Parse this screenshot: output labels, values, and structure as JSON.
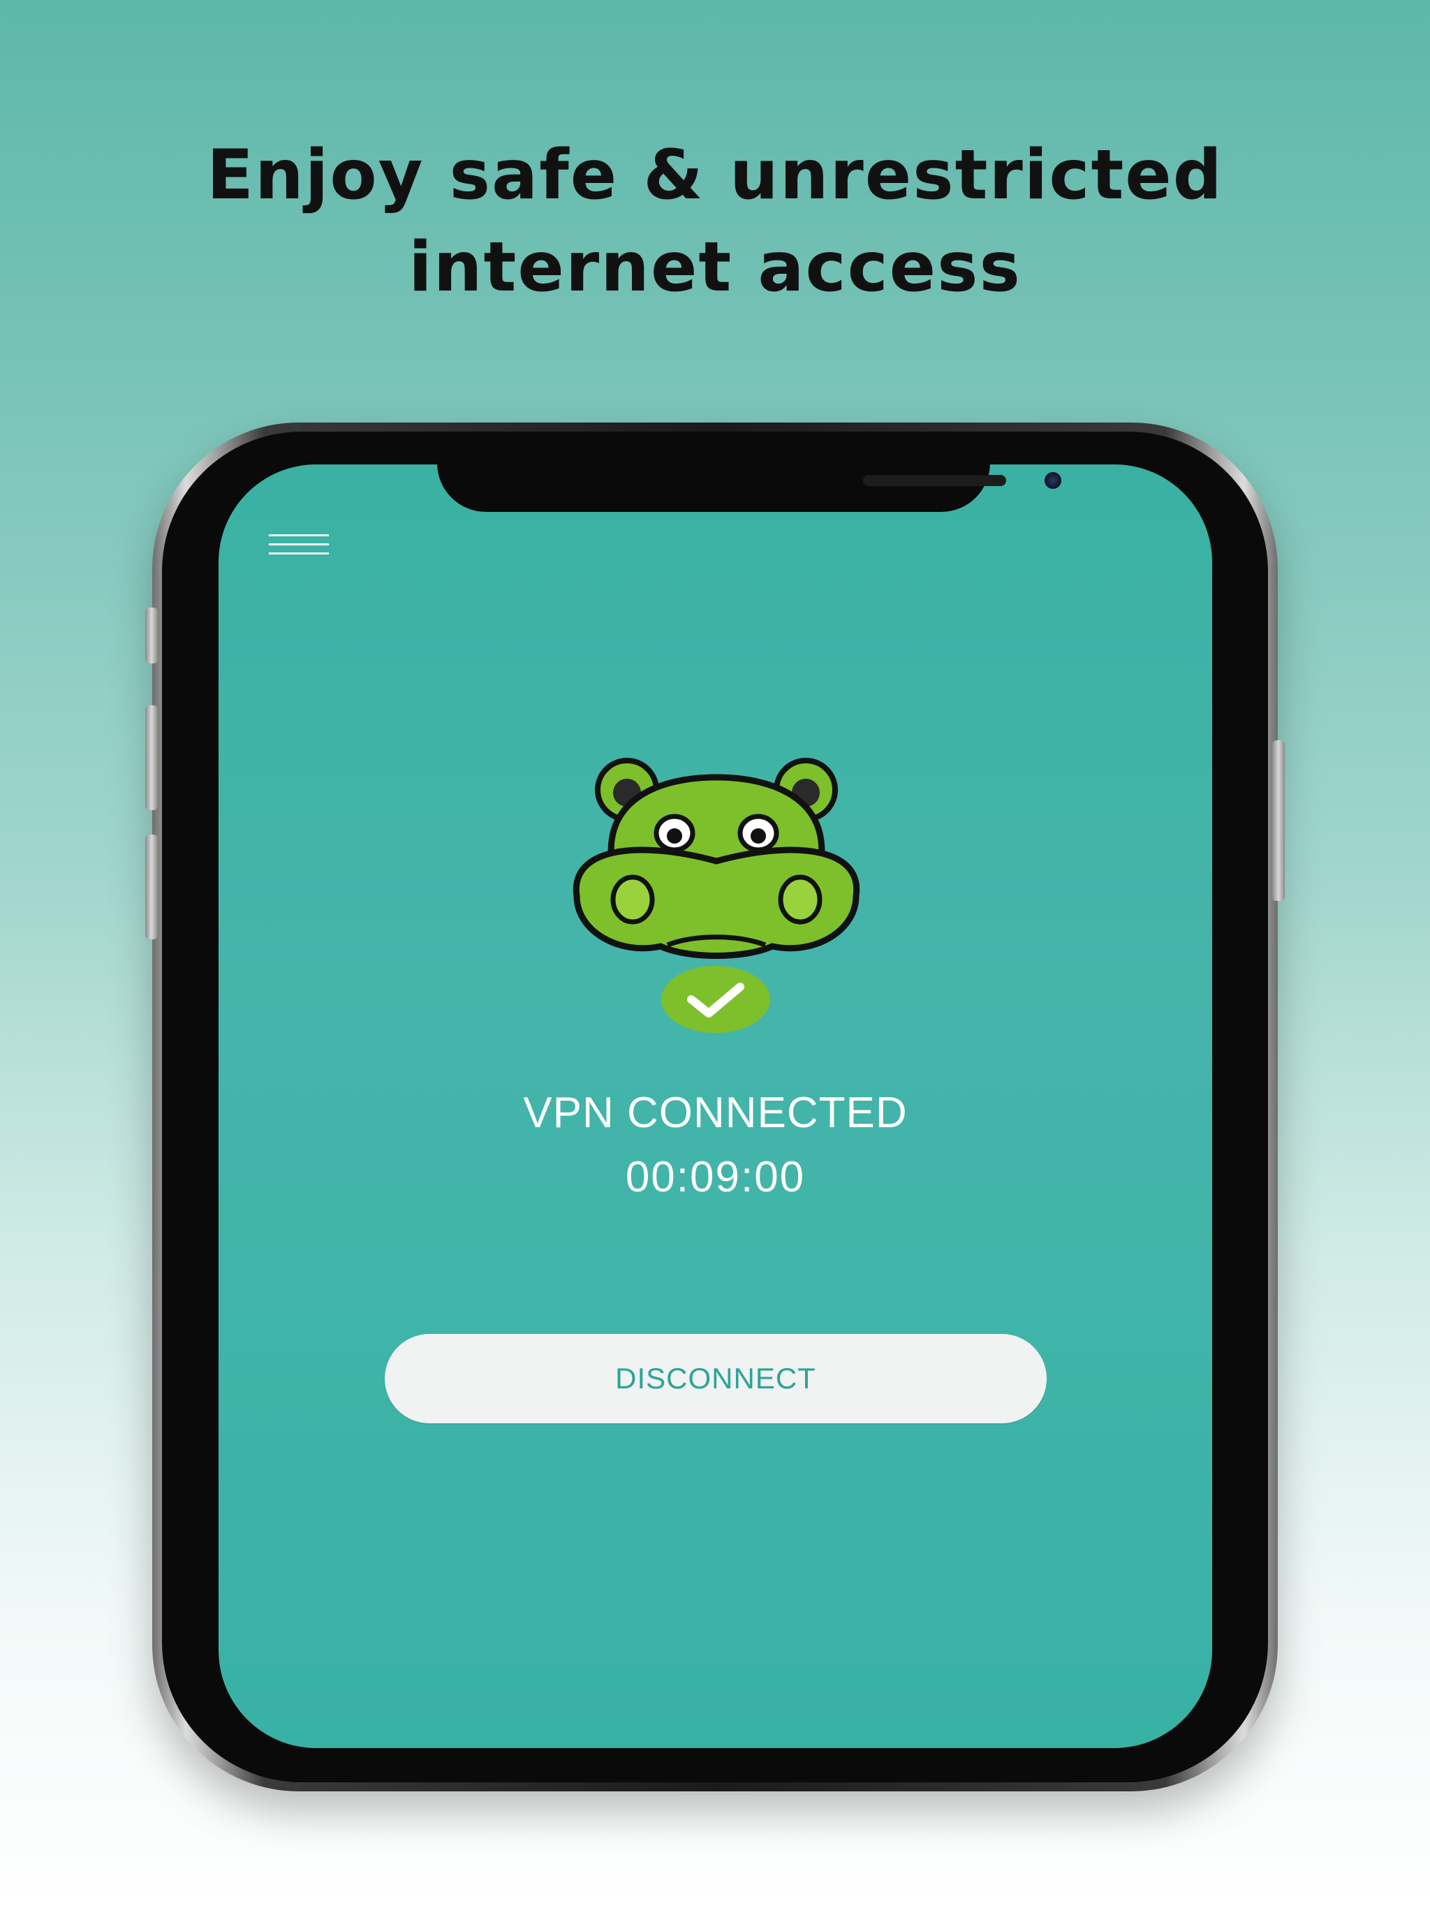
{
  "headline": {
    "line1": "Enjoy safe & unrestricted",
    "line2": "internet access"
  },
  "app": {
    "menu_icon": "hamburger-menu-icon",
    "mascot": "hippo-mascot-logo",
    "status_icon": "checkmark-icon",
    "status_text": "VPN CONNECTED",
    "timer": "00:09:00",
    "disconnect_label": "DISCONNECT"
  },
  "colors": {
    "screen_bg": "#3ab1a3",
    "accent_green": "#7dc02b",
    "button_bg": "#f1f2f2",
    "button_text": "#2aa596"
  }
}
